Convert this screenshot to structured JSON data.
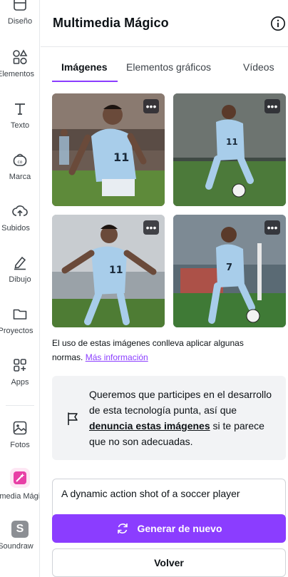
{
  "sidebar": {
    "items": [
      {
        "label": "Diseño",
        "icon": "layout-icon"
      },
      {
        "label": "Elementos",
        "icon": "shapes-icon"
      },
      {
        "label": "Texto",
        "icon": "text-icon"
      },
      {
        "label": "Marca",
        "icon": "brand-icon"
      },
      {
        "label": "Subidos",
        "icon": "upload-cloud-icon"
      },
      {
        "label": "Dibujo",
        "icon": "draw-pen-icon"
      },
      {
        "label": "Proyectos",
        "icon": "folder-icon"
      },
      {
        "label": "Apps",
        "icon": "apps-icon"
      },
      {
        "label": "Fotos",
        "icon": "photo-icon"
      },
      {
        "label": "Multimedia Mágico",
        "icon": "magic-media-icon"
      },
      {
        "label": "Soundraw",
        "icon": "soundraw-icon"
      }
    ]
  },
  "panel": {
    "title": "Multimedia Mágico",
    "tabs": [
      {
        "label": "Imágenes",
        "active": true
      },
      {
        "label": "Elementos gráficos",
        "active": false
      },
      {
        "label": "Vídeos",
        "active": false
      }
    ],
    "more_glyph": "•••",
    "images": [
      {
        "alt": "Soccer player celebrating",
        "jersey": "11"
      },
      {
        "alt": "Soccer player dribbling ball",
        "jersey": "11"
      },
      {
        "alt": "Soccer player running",
        "jersey": "11"
      },
      {
        "alt": "Soccer player kicking ball",
        "jersey": "7"
      }
    ],
    "note_text": "El uso de estas imágenes conlleva aplicar algunas normas.",
    "note_link": "Más información",
    "report": {
      "text_before": "Queremos que participes en el desarrollo de esta tecnología punta, así que ",
      "link": "denuncia estas imágenes",
      "text_after": " si te parece que no son adecuadas."
    },
    "prompt_value": "A dynamic action shot of a soccer player",
    "generate_label": "Generar de nuevo",
    "back_label": "Volver"
  },
  "colors": {
    "accent": "#8b3dff",
    "report_bg": "#f2f3f5",
    "magic_tile": "#fde7f4",
    "sky_jersey": "#a8cdea"
  }
}
